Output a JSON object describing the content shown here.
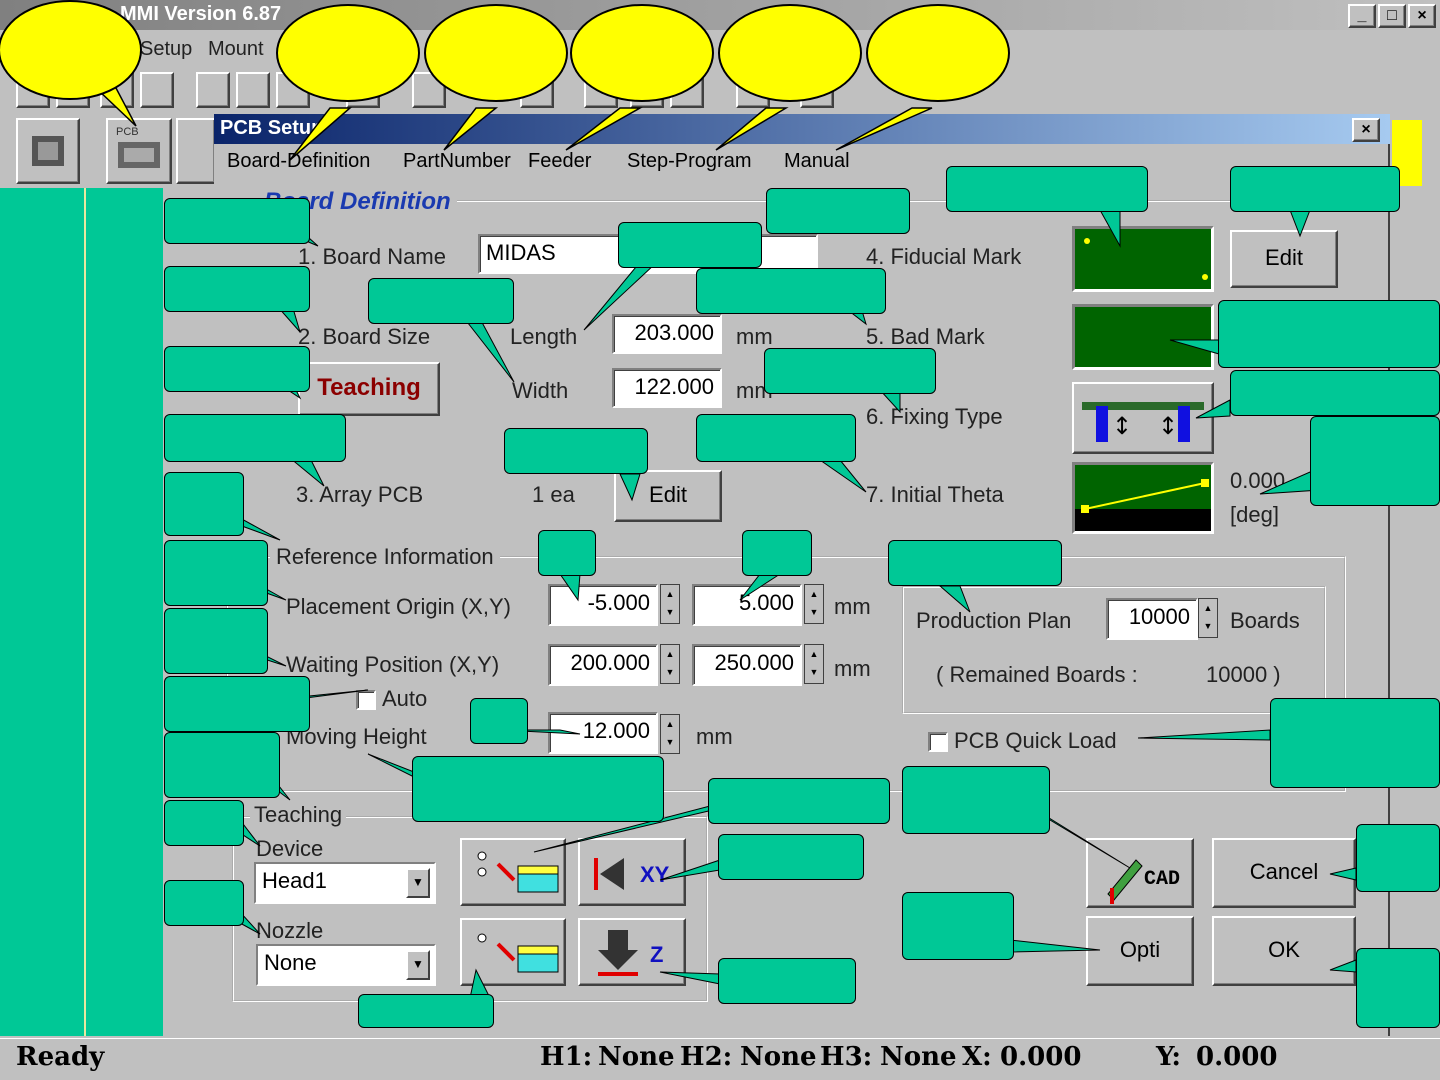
{
  "app": {
    "title": "MMI Version 6.87",
    "window_buttons": [
      "_",
      "□",
      "×"
    ],
    "menu": [
      "Setup",
      "Mount"
    ],
    "sidebar_icon_label": "PCB"
  },
  "dialog": {
    "title": "PCB Setup",
    "close": "×",
    "tabs": [
      "Board-Definition",
      "PartNumber",
      "Feeder",
      "Step-Program",
      "Manual"
    ],
    "section_title": "Board Definition",
    "board_name_label": "1. Board Name",
    "board_name_value": "MIDAS",
    "board_size_label": "2. Board Size",
    "length_label": "Length",
    "length_value": "203.000",
    "width_label": "Width",
    "width_value": "122.000",
    "mm": "mm",
    "teaching_button": "Teaching",
    "array_label": "3. Array PCB",
    "array_value": "1 ea",
    "edit": "Edit",
    "fiducial_label": "4. Fiducial Mark",
    "bad_mark_label": "5. Bad Mark",
    "fixing_label": "6. Fixing Type",
    "theta_label": "7. Initial Theta",
    "theta_value": "0.000",
    "theta_unit": "[deg]",
    "reference_title": "Reference Information",
    "placement_label": "Placement Origin (X,Y)",
    "placement_x": "-5.000",
    "placement_y": "5.000",
    "waiting_label": "Waiting Position (X,Y)",
    "waiting_x": "200.000",
    "waiting_y": "250.000",
    "auto_label": "Auto",
    "moving_label": "Moving Height",
    "moving_value": "12.000",
    "production_label": "Production Plan",
    "production_value": "10000",
    "boards": "Boards",
    "remained": "( Remained Boards :",
    "remained_value": "10000 )",
    "quick_load": "PCB Quick Load",
    "teaching_group": "Teaching",
    "device_label": "Device",
    "device_value": "Head1",
    "nozzle_label": "Nozzle",
    "nozzle_value": "None",
    "xy_label": "XY",
    "z_label": "Z",
    "cad_label": "CAD",
    "opti_label": "Opti",
    "cancel_label": "Cancel",
    "ok_label": "OK"
  },
  "status": {
    "ready": "Ready",
    "h1": "H1:",
    "h1_val": "None",
    "h2": "H2:",
    "h2_val": "None",
    "h3": "H3:",
    "h3_val": "None",
    "x": "X:",
    "x_val": "0.000",
    "y": "Y:",
    "y_val": "0.000"
  },
  "colors": {
    "callout": "#00c896",
    "bubble": "#ffff00",
    "panel_green": "#006400",
    "dialog_title": "#0a246a"
  }
}
